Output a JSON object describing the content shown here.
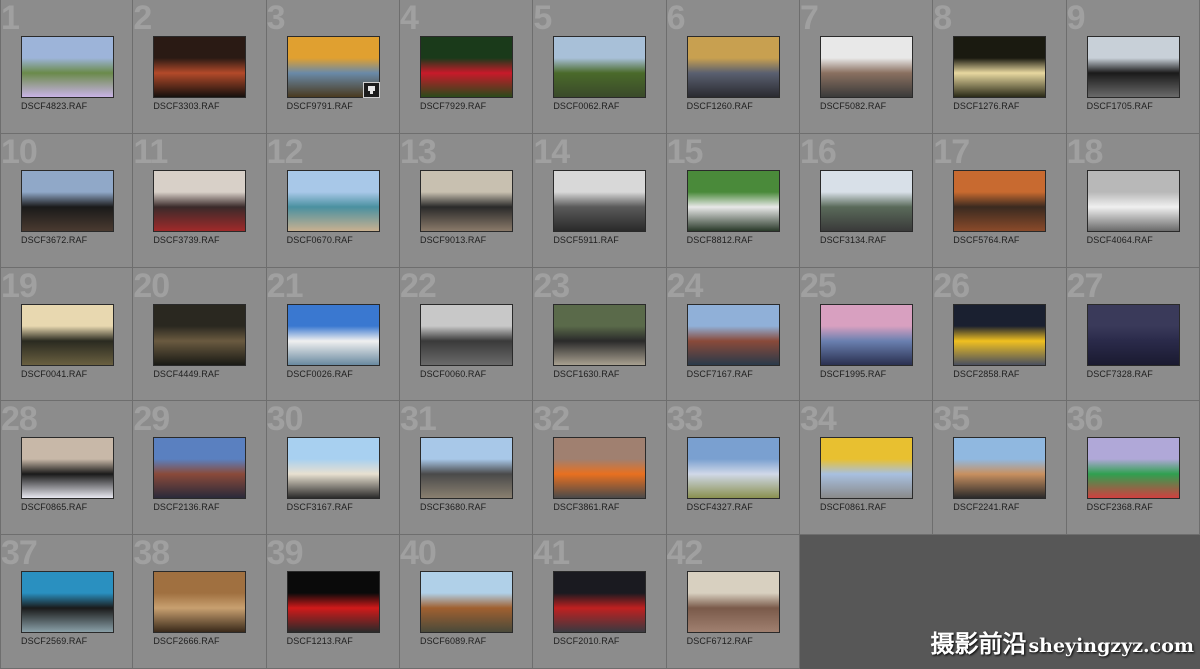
{
  "grid": {
    "cells": [
      {
        "num": "1",
        "file": "DSCF4823.RAF",
        "thumb": [
          "#9db4d9",
          "#6a8a4a",
          "#c9b3e6"
        ]
      },
      {
        "num": "2",
        "file": "DSCF3303.RAF",
        "thumb": [
          "#2a1a14",
          "#b34a2a",
          "#15100d"
        ]
      },
      {
        "num": "3",
        "file": "DSCF9791.RAF",
        "thumb": [
          "#e0a030",
          "#6a8aa8",
          "#4a3a20"
        ],
        "badge": true
      },
      {
        "num": "4",
        "file": "DSCF7929.RAF",
        "thumb": [
          "#1a3a1a",
          "#c81a2a",
          "#2a4a1a"
        ]
      },
      {
        "num": "5",
        "file": "DSCF0062.RAF",
        "thumb": [
          "#a8c0d8",
          "#4a6a2a",
          "#3a4a2a"
        ]
      },
      {
        "num": "6",
        "file": "DSCF1260.RAF",
        "thumb": [
          "#c8a050",
          "#5a6070",
          "#2a2a30"
        ]
      },
      {
        "num": "7",
        "file": "DSCF5082.RAF",
        "thumb": [
          "#e8e8e8",
          "#8a7060",
          "#3a3a3a"
        ]
      },
      {
        "num": "8",
        "file": "DSCF1276.RAF",
        "thumb": [
          "#1a1a10",
          "#e8d8a0",
          "#2a2a18"
        ]
      },
      {
        "num": "9",
        "file": "DSCF1705.RAF",
        "thumb": [
          "#c8d0d8",
          "#1a1a1a",
          "#6a6a6a"
        ]
      },
      {
        "num": "10",
        "file": "DSCF3672.RAF",
        "thumb": [
          "#90a8c8",
          "#1a1a1a",
          "#4a3a30"
        ]
      },
      {
        "num": "11",
        "file": "DSCF3739.RAF",
        "thumb": [
          "#d8d0c8",
          "#3a2a2a",
          "#a02a2a"
        ]
      },
      {
        "num": "12",
        "file": "DSCF0670.RAF",
        "thumb": [
          "#a8c8e8",
          "#4a90a0",
          "#c8b090"
        ]
      },
      {
        "num": "13",
        "file": "DSCF9013.RAF",
        "thumb": [
          "#c8c0b0",
          "#2a2a2a",
          "#8a7a6a"
        ]
      },
      {
        "num": "14",
        "file": "DSCF5911.RAF",
        "thumb": [
          "#d8d8d8",
          "#5a5a5a",
          "#2a2a2a"
        ]
      },
      {
        "num": "15",
        "file": "DSCF8812.RAF",
        "thumb": [
          "#4a8a3a",
          "#e8e8e8",
          "#2a3a2a"
        ]
      },
      {
        "num": "16",
        "file": "DSCF3134.RAF",
        "thumb": [
          "#d8e0e8",
          "#5a6a5a",
          "#3a3a3a"
        ]
      },
      {
        "num": "17",
        "file": "DSCF5764.RAF",
        "thumb": [
          "#c86a30",
          "#3a2a20",
          "#8a4a2a"
        ]
      },
      {
        "num": "18",
        "file": "DSCF4064.RAF",
        "thumb": [
          "#b8b8b8",
          "#f0f0f0",
          "#6a6a6a"
        ]
      },
      {
        "num": "19",
        "file": "DSCF0041.RAF",
        "thumb": [
          "#e8d8b0",
          "#2a2a20",
          "#6a6040"
        ]
      },
      {
        "num": "20",
        "file": "DSCF4449.RAF",
        "thumb": [
          "#2a2820",
          "#6a5a40",
          "#1a1a15"
        ]
      },
      {
        "num": "21",
        "file": "DSCF0026.RAF",
        "thumb": [
          "#3a78d0",
          "#f0f0f0",
          "#6a8aa0"
        ]
      },
      {
        "num": "22",
        "file": "DSCF0060.RAF",
        "thumb": [
          "#c8c8c8",
          "#3a3a3a",
          "#6a6a6a"
        ]
      },
      {
        "num": "23",
        "file": "DSCF1630.RAF",
        "thumb": [
          "#5a6a4a",
          "#2a2a2a",
          "#a8a090"
        ]
      },
      {
        "num": "24",
        "file": "DSCF7167.RAF",
        "thumb": [
          "#90b0d8",
          "#8a4a3a",
          "#2a3a4a"
        ]
      },
      {
        "num": "25",
        "file": "DSCF1995.RAF",
        "thumb": [
          "#d8a0c0",
          "#6a80b0",
          "#2a3050"
        ]
      },
      {
        "num": "26",
        "file": "DSCF2858.RAF",
        "thumb": [
          "#1a2030",
          "#f0c020",
          "#4a5060"
        ]
      },
      {
        "num": "27",
        "file": "DSCF7328.RAF",
        "thumb": [
          "#3a3a5a",
          "#2a2a4a",
          "#1a1a30"
        ]
      },
      {
        "num": "28",
        "file": "DSCF0865.RAF",
        "thumb": [
          "#c8b8a8",
          "#1a1a1a",
          "#e8e8f0"
        ]
      },
      {
        "num": "29",
        "file": "DSCF2136.RAF",
        "thumb": [
          "#5a80c0",
          "#8a4a3a",
          "#2a2a3a"
        ]
      },
      {
        "num": "30",
        "file": "DSCF3167.RAF",
        "thumb": [
          "#a8d0f0",
          "#e8e0d0",
          "#2a2a2a"
        ]
      },
      {
        "num": "31",
        "file": "DSCF3680.RAF",
        "thumb": [
          "#a8c8e8",
          "#4a4a4a",
          "#8a8070"
        ]
      },
      {
        "num": "32",
        "file": "DSCF3861.RAF",
        "thumb": [
          "#a08070",
          "#e87020",
          "#4a4a4a"
        ]
      },
      {
        "num": "33",
        "file": "DSCF4327.RAF",
        "thumb": [
          "#7aa0d0",
          "#d0d8e8",
          "#8a9050"
        ]
      },
      {
        "num": "34",
        "file": "DSCF0861.RAF",
        "thumb": [
          "#e8c030",
          "#a8c0e0",
          "#8a8a8a"
        ]
      },
      {
        "num": "35",
        "file": "DSCF2241.RAF",
        "thumb": [
          "#90b8e0",
          "#c89060",
          "#2a2a2a"
        ]
      },
      {
        "num": "36",
        "file": "DSCF2368.RAF",
        "thumb": [
          "#b0a8d8",
          "#30a050",
          "#d04040"
        ]
      },
      {
        "num": "37",
        "file": "DSCF2569.RAF",
        "thumb": [
          "#2a90c0",
          "#1a1a1a",
          "#8aa0a8"
        ]
      },
      {
        "num": "38",
        "file": "DSCF2666.RAF",
        "thumb": [
          "#a07040",
          "#c8a070",
          "#3a2a1a"
        ]
      },
      {
        "num": "39",
        "file": "DSCF1213.RAF",
        "thumb": [
          "#0a0a0a",
          "#d01a1a",
          "#2a2a2a"
        ]
      },
      {
        "num": "40",
        "file": "DSCF6089.RAF",
        "thumb": [
          "#b0d0e8",
          "#a06030",
          "#4a4a3a"
        ]
      },
      {
        "num": "41",
        "file": "DSCF2010.RAF",
        "thumb": [
          "#1a1a20",
          "#c02020",
          "#3a3a40"
        ]
      },
      {
        "num": "42",
        "file": "DSCF6712.RAF",
        "thumb": [
          "#d8d0c0",
          "#7a5a4a",
          "#a08070"
        ]
      }
    ]
  },
  "watermark": {
    "zh": "摄影前沿",
    "en": "sheyingzyz.com"
  }
}
